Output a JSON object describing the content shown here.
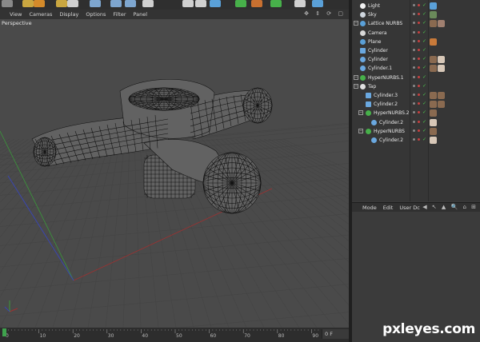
{
  "viewport": {
    "menu": [
      "View",
      "Cameras",
      "Display",
      "Options",
      "Filter",
      "Panel"
    ],
    "label": "Perspective",
    "nav_icons": "✥ ⇕ ⟳ ▢"
  },
  "timeline": {
    "ticks": [
      "0",
      "10",
      "20",
      "30",
      "40",
      "50",
      "60",
      "70",
      "80",
      "90"
    ],
    "frame": "0 F"
  },
  "objects": [
    {
      "name": "Light",
      "indent": 0,
      "icon": "light-icon",
      "expand": false
    },
    {
      "name": "Sky",
      "indent": 0,
      "icon": "sky-icon",
      "expand": false
    },
    {
      "name": "Lattice NURBS",
      "indent": 0,
      "icon": "lathe-nurbs-icon",
      "expand": true
    },
    {
      "name": "Camera",
      "indent": 0,
      "icon": "camera-icon",
      "expand": false
    },
    {
      "name": "Plane",
      "indent": 0,
      "icon": "plane-icon",
      "expand": false
    },
    {
      "name": "Cylinder",
      "indent": 0,
      "icon": "cylinder-icon",
      "expand": false
    },
    {
      "name": "Cylinder",
      "indent": 0,
      "icon": "cone-icon",
      "expand": false
    },
    {
      "name": "Cylinder.1",
      "indent": 0,
      "icon": "cone-icon",
      "expand": false
    },
    {
      "name": "HyperNURBS.1",
      "indent": 0,
      "icon": "hypernurbs-icon",
      "expand": true
    },
    {
      "name": "Tap",
      "indent": 0,
      "icon": "null-icon",
      "expand": true
    },
    {
      "name": "Cylinder.3",
      "indent": 1,
      "icon": "cylinder-icon",
      "expand": false
    },
    {
      "name": "Cylinder.2",
      "indent": 1,
      "icon": "cylinder-icon",
      "expand": false
    },
    {
      "name": "HyperNURBS.2",
      "indent": 1,
      "icon": "hypernurbs-icon",
      "expand": true
    },
    {
      "name": "Cylinder.2",
      "indent": 2,
      "icon": "cone-icon",
      "expand": false
    },
    {
      "name": "HyperNURBS",
      "indent": 1,
      "icon": "hypernurbs-icon",
      "expand": true
    },
    {
      "name": "Cylinder.2",
      "indent": 2,
      "icon": "cone-icon",
      "expand": false
    }
  ],
  "attributes": {
    "menu": [
      "Mode",
      "Edit",
      "User Dc"
    ],
    "icons": "◀ ↖ ▲ 🔍 ⌂ ⊞"
  },
  "colors": {
    "accent_blue": "#5aa0d8",
    "mesh_line": "#111111",
    "axis_red": "#a03030",
    "axis_green": "#3a9a3a",
    "axis_blue": "#3a46b0"
  },
  "watermark": "pxleyes.com"
}
